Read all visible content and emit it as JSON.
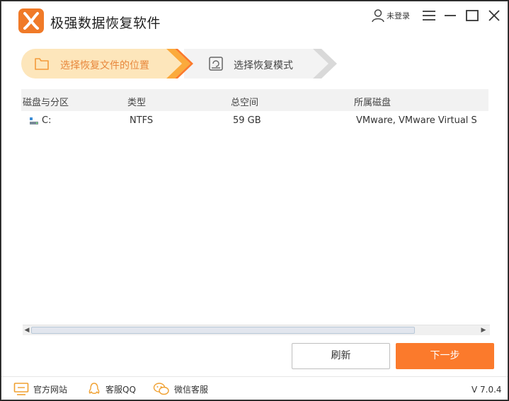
{
  "app": {
    "title": "极强数据恢复软件",
    "brand_color": "#f07a28"
  },
  "header": {
    "user_label": "未登录",
    "icons": [
      "user-icon",
      "menu-icon",
      "minimize-icon",
      "maximize-icon",
      "close-icon"
    ]
  },
  "steps": [
    {
      "label": "选择恢复文件的位置",
      "active": true,
      "icon": "folder-icon"
    },
    {
      "label": "选择恢复模式",
      "active": false,
      "icon": "disk-restore-icon"
    }
  ],
  "table": {
    "columns": [
      "磁盘与分区",
      "类型",
      "总空间",
      "所属磁盘"
    ],
    "rows": [
      {
        "partition": "C:",
        "type": "NTFS",
        "size": "59 GB",
        "disk": "VMware, VMware Virtual S"
      }
    ]
  },
  "buttons": {
    "refresh": "刷新",
    "next": "下一步",
    "next_color": "#fb7a2c"
  },
  "footer": {
    "website": "官方网站",
    "qq": "客服QQ",
    "wechat": "微信客服",
    "version": "V 7.0.4"
  }
}
